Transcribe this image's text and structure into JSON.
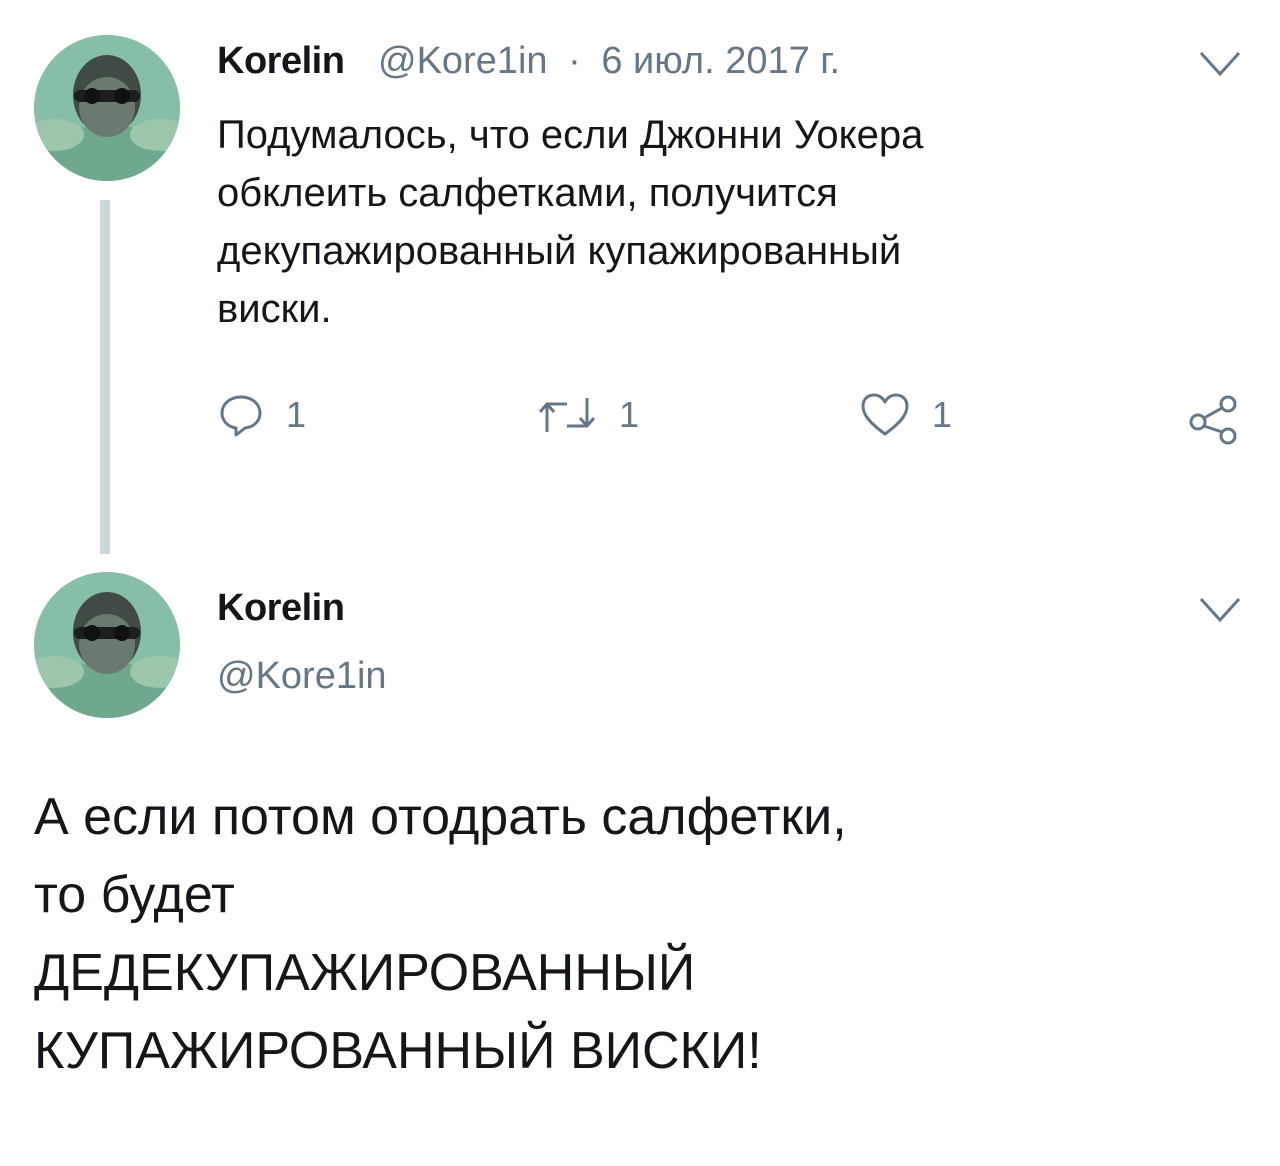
{
  "tweet": {
    "author_name": "Korelin",
    "author_handle": "@Kore1in",
    "separator": "·",
    "date": "6 июл. 2017 г.",
    "text": "Подумалось, что если Джонни Уокера\nобклеить салфетками, получится\nдекупажированный купажированный\nвиски.",
    "actions": {
      "reply_icon": "reply-icon",
      "reply_count": "1",
      "retweet_icon": "retweet-icon",
      "retweet_count": "1",
      "like_icon": "heart-icon",
      "like_count": "1",
      "share_icon": "share-icon"
    },
    "menu_icon": "chevron-down-icon"
  },
  "reply": {
    "author_name": "Korelin",
    "author_handle": "@Kore1in",
    "menu_icon": "chevron-down-icon",
    "text": "А если потом отодрать салфетки,\nто будет\nДЕДЕКУПАЖИРОВАННЫЙ\nКУПАЖИРОВАННЫЙ ВИСКИ!"
  },
  "colors": {
    "text_primary": "#14171a",
    "text_secondary": "#657786",
    "thread_line": "#ccd6dd",
    "avatar_water": "#7fb89e"
  }
}
